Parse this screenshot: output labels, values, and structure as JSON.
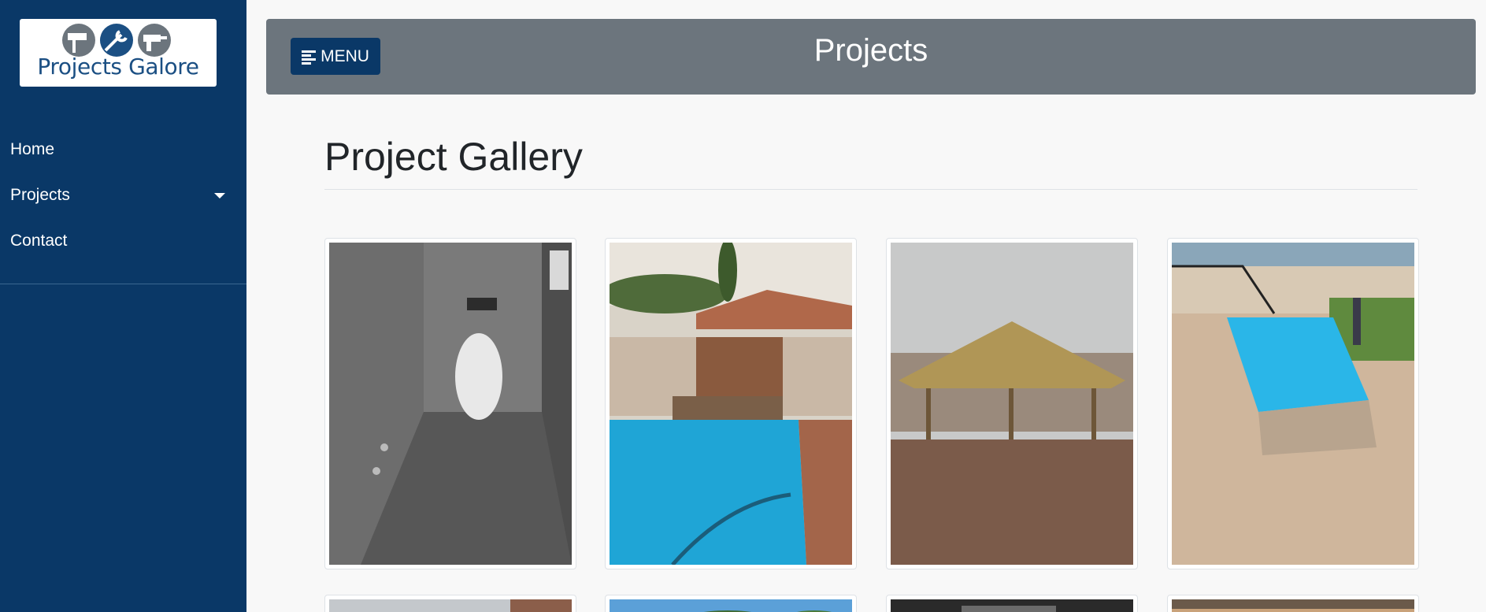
{
  "logo": {
    "text": "Projects Galore"
  },
  "nav": {
    "items": [
      {
        "label": "Home"
      },
      {
        "label": "Projects"
      },
      {
        "label": "Contact"
      }
    ]
  },
  "header": {
    "menu_label": "MENU",
    "title": "Projects"
  },
  "gallery": {
    "title": "Project Gallery",
    "images": [
      {
        "subject": "bathroom with wall-hung toilet"
      },
      {
        "subject": "pool with water feature"
      },
      {
        "subject": "thatched lapa"
      },
      {
        "subject": "pool with paved deck"
      },
      {
        "subject": "building exterior"
      },
      {
        "subject": "trees and sky"
      },
      {
        "subject": "interior ceiling"
      },
      {
        "subject": "interior lighting"
      }
    ]
  },
  "colors": {
    "sidebar": "#0a3867",
    "header": "#6c757d",
    "background": "#f8f8f8"
  }
}
